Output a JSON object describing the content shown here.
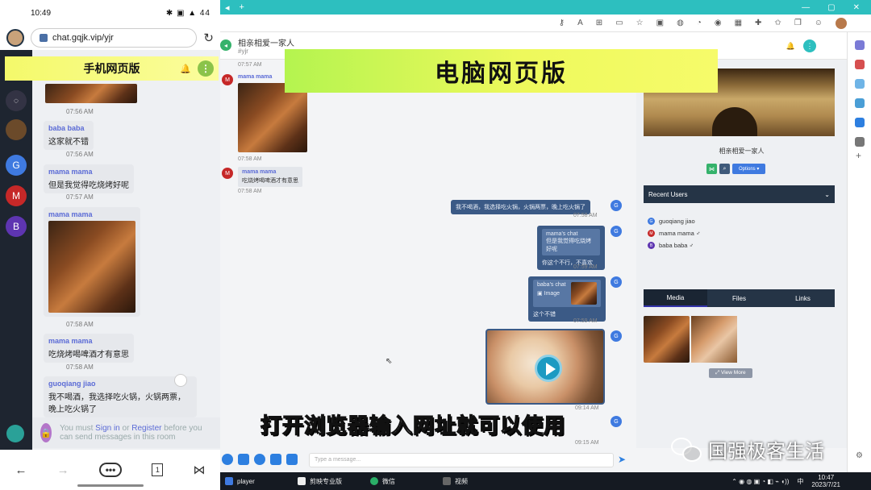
{
  "phone": {
    "status_time": "10:49",
    "status_icons": "✱ ▣ ▲ 44",
    "url": "chat.gqjk.vip/yjr",
    "header_title": "手机网页版",
    "messages": [
      {
        "time": "07:56 AM"
      },
      {
        "name": "baba baba",
        "text": "这家就不错",
        "time": "07:56 AM"
      },
      {
        "name": "mama mama",
        "text": "但是我觉得吃烧烤好呢",
        "time": "07:57 AM"
      },
      {
        "name": "mama mama",
        "time": "07:58 AM"
      },
      {
        "name": "mama mama",
        "text": "吃烧烤喝啤酒才有意思",
        "time": "07:58 AM"
      },
      {
        "name": "guoqiang jiao",
        "text": "我不喝酒，我选择吃火锅，火锅两票，晚上吃火锅了"
      }
    ],
    "login_prefix": "You must",
    "login_signin": "Sign in",
    "login_or": "or",
    "login_register": "Register",
    "login_suffix": "before you can send messages in this room",
    "rail_avatars": [
      "G",
      "M",
      "B"
    ],
    "nav_page": "1"
  },
  "browser": {
    "chat_title": "相亲相爱一家人",
    "chat_sub": "#yjr",
    "banner": "电脑网页版",
    "messages": [
      {
        "time": "07:57 AM"
      },
      {
        "avatar": "M",
        "name": "mama mama",
        "time": "07:58 AM"
      },
      {
        "avatar": "M",
        "name": "mama mama",
        "text": "吃烧烤喝啤酒才有意思",
        "time": "07:58 AM"
      }
    ],
    "outgoing": [
      {
        "text": "我不喝酒，我选择吃火锅，火锅两票，晚上吃火锅了",
        "time": "07:58 AM"
      },
      {
        "quote_name": "mama's chat",
        "quote_text": "但是我觉得吃烧烤好呢",
        "text": "你这个不行，不喜欢",
        "time": "07:59 AM"
      },
      {
        "quote_name": "baba's chat",
        "quote_text": "Image",
        "text": "这个不错",
        "time": "07:59 AM"
      },
      {
        "time": "09:14 AM"
      },
      {
        "time": "09:15 AM"
      }
    ],
    "out_avatar": "G",
    "input_placeholder": "Type a message...",
    "subtitle": "打开浏览器输入网址就可以使用",
    "panel": {
      "group_name": "相亲相爱一家人",
      "options_label": "Options ▾",
      "recent_users_label": "Recent Users",
      "users": [
        {
          "initial": "G",
          "name": "guoqiang jiao",
          "color": "#3f7ae0"
        },
        {
          "initial": "M",
          "name": "mama mama ♂",
          "color": "#c62828"
        },
        {
          "initial": "B",
          "name": "baba baba ♂",
          "color": "#5e35b1"
        }
      ],
      "tabs": [
        "Media",
        "Files",
        "Links"
      ],
      "view_more": "View More"
    }
  },
  "taskbar": {
    "items": [
      "player",
      "剪映专业版",
      "微信",
      "视频"
    ],
    "clock_time": "10:47",
    "clock_date": "2023/7/21",
    "ime": "中"
  },
  "watermark": "国强极客生活"
}
